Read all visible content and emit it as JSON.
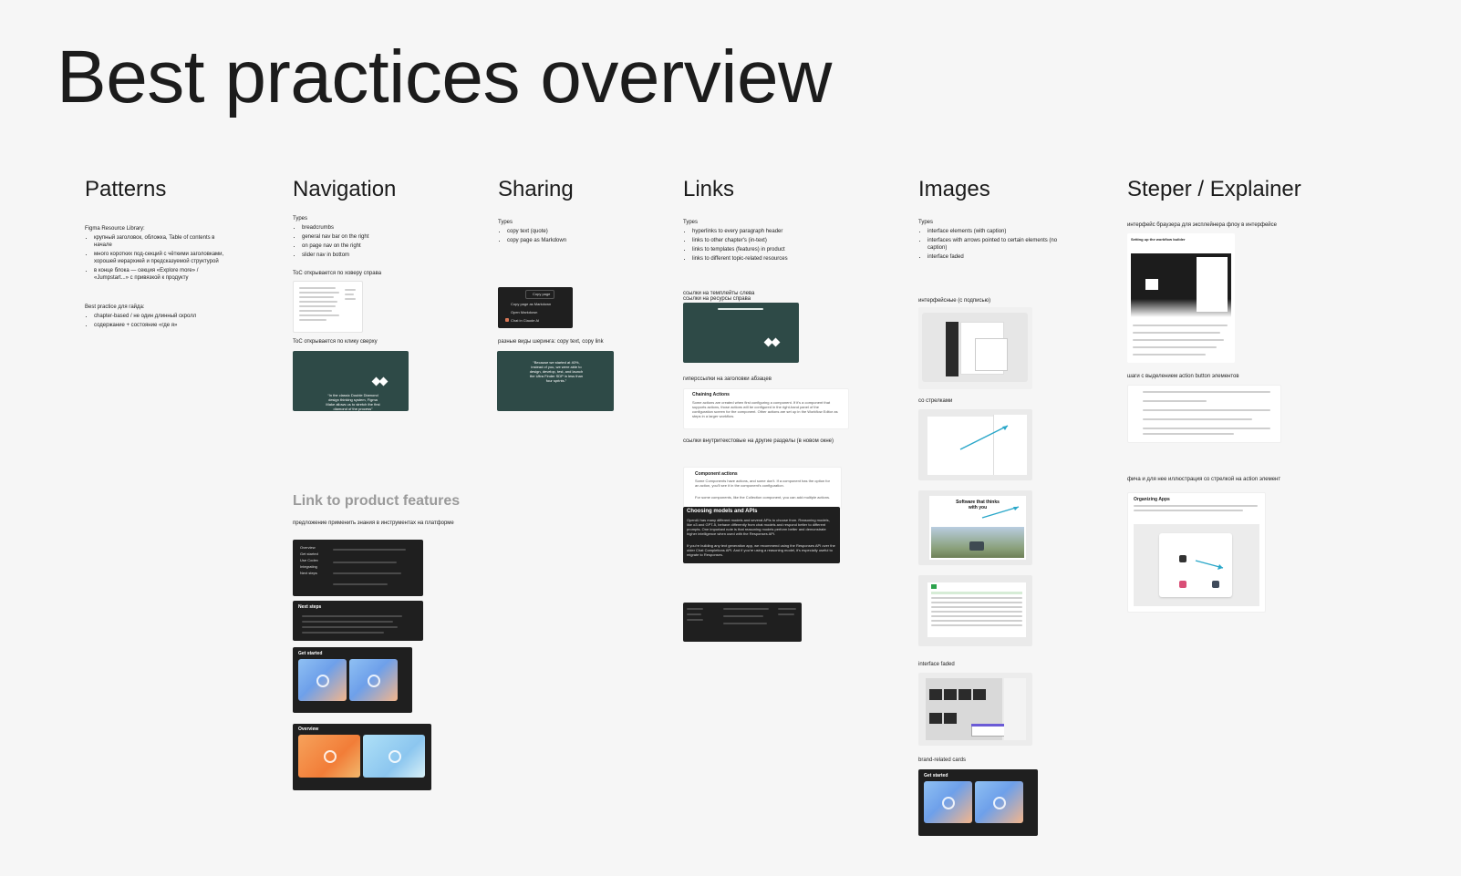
{
  "page": {
    "title": "Best practices overview"
  },
  "columns": [
    {
      "id": "patterns",
      "heading": "Patterns"
    },
    {
      "id": "navigation",
      "heading": "Navigation"
    },
    {
      "id": "sharing",
      "heading": "Sharing"
    },
    {
      "id": "links",
      "heading": "Links"
    },
    {
      "id": "images",
      "heading": "Images"
    },
    {
      "id": "steper",
      "heading": "Steper / Explainer"
    }
  ],
  "patterns": {
    "lib_title": "Figma Resource Library:",
    "lib_items": [
      "крупный заголовок, обложка, Table of contents в начале",
      "много коротких под-секций с чёткими заголовками, хорошей иерархией и предсказуемой структурой",
      "в конце блока — секция «Explore more» / «Jumpstart...» с привязкой к продукту"
    ],
    "guide_title": "Best practice для гайда:",
    "guide_items": [
      "chapter-based / не один длинный скролл",
      "содержание + состояние «где я»"
    ]
  },
  "navigation": {
    "types_label": "Types",
    "types": [
      "breadcrumbs",
      "general nav bar on the right",
      "on page nav on the right",
      "slider nav in bottom"
    ],
    "toc_right": "ToC открывается по ховеру справа",
    "toc_top": "ToC открывается по клику сверху",
    "teal_quote": "“In the classic Double Diamond design thinking system, Figma Make allows us to stretch the first diamond of the process”"
  },
  "sharing": {
    "types_label": "Types",
    "types": [
      "copy text (quote)",
      "copy page as Markdown"
    ],
    "copy_page_btn": "Copy page",
    "menu": [
      "Copy page as Markdown",
      "Open Markdown",
      "Chat in Claude AI"
    ],
    "variants_label": "разные виды шеринга: copy text, copy link",
    "teal_quote": "“Because we started at 40%, instead of you, we were able to design, develop, test, and launch the Ultra Finder SDP in less than four sprints.”"
  },
  "links": {
    "types_label": "Types",
    "types": [
      "hyperlinks to every paragraph header",
      "links to other chapter's (in-text)",
      "links to templates (features) in product",
      "links to different topic-related resources"
    ],
    "templates_label_1": "ссылки на темплейты слева",
    "templates_label_2": "ссылки на ресурсы справа",
    "header_links_label": "гиперссылки на заголовки абзацев",
    "chaining_title": "Chaining Actions",
    "chaining_text": "Some actions are created when first configuring a component. If it's a component that supports actions, those actions will be configured in the right-hand panel of the configuration screen for the component. Other actions are set up in the Workflow Editor as steps in a larger workflow.",
    "internal_links_label": "ссылки внутритекстовые на другие разделы (в новом окне)",
    "component_title": "Component actions",
    "component_text": "Some Components have actions, and some don't. If a component has the option for an action, you'll see it in the component's configuration.",
    "component_text2": "For some components, like the Collection component, you can add multiple actions.",
    "models_title": "Choosing models and APIs",
    "models_text": "OpenAI has many different models and several APIs to choose from. Reasoning models, like o3 and GPT-5, behave differently from chat models and respond better to different prompts. One important note is that reasoning models perform better and demonstrate higher intelligence when used with the Responses API.",
    "models_text2": "If you're building any text generation app, we recommend using the Responses API over the older Chat Completions API. And if you're using a reasoning model, it's especially useful to migrate to Responses."
  },
  "images": {
    "types_label": "Types",
    "types": [
      "interface elements (with caption)",
      "interfaces with arrows pointed to certain elements (no caption)",
      "interface faded"
    ],
    "captioned_label": "интерфейсные (с подписью)",
    "arrows_label": "со стрелками",
    "hero_text": "Software that thinks with you",
    "faded_label": "interface faded",
    "brand_label": "brand-related cards",
    "get_started": "Get started"
  },
  "steper": {
    "browser_label": "интерфейс браузера для эксплейнера флоу в интерфейсе",
    "setup_title": "Setting up the workflow builder",
    "steps_label": "шаги с выделением action button элементов",
    "feature_label": "фича и для нее иллюстрация со стрелкой на action элемент",
    "org_title": "Organizing Apps"
  },
  "product_features": {
    "heading": "Link to product features",
    "subtitle": "предложение применить знания в инструментах на платформе",
    "next_steps": "Next steps",
    "get_started": "Get started",
    "overview": "Overview"
  }
}
